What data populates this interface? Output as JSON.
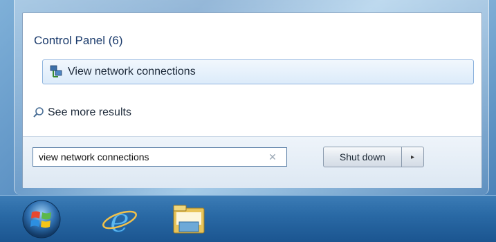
{
  "search_results": {
    "group_header": "Control Panel (6)",
    "items": [
      {
        "label": "View network connections",
        "icon": "network-connections-icon"
      }
    ],
    "see_more": "See more results"
  },
  "search": {
    "value": "view network connections",
    "clear_icon": "clear-x-icon"
  },
  "power": {
    "shutdown_label": "Shut down",
    "arrow_icon": "chevron-right-icon"
  },
  "taskbar": {
    "items": [
      {
        "name": "start-orb",
        "icon": "windows-logo-icon"
      },
      {
        "name": "internet-explorer",
        "icon": "ie-icon"
      },
      {
        "name": "windows-explorer",
        "icon": "folder-icon"
      }
    ]
  },
  "colors": {
    "taskbar": "#2a6aa6",
    "accent": "#8fb4de"
  }
}
